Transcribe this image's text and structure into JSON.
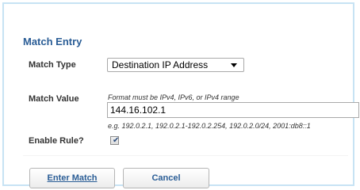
{
  "form": {
    "title": "Match Entry",
    "match_type_label": "Match Type",
    "match_type_value": "Destination IP Address",
    "match_value_label": "Match Value",
    "format_hint": "Format must be IPv4, IPv6, or IPv4 range",
    "match_value": "144.16.102.1",
    "example_text": "e.g. 192.0.2.1, 192.0.2.1-192.0.2.254, 192.0.2.0/24, 2001:db8::1",
    "enable_rule_label": "Enable Rule?",
    "enable_rule_checked": true
  },
  "buttons": {
    "enter_match": "Enter Match",
    "cancel": "Cancel"
  },
  "colors": {
    "accent": "#2a5d96",
    "panel_border": "#c7e3f4"
  },
  "icons": {
    "dropdown": "chevron-down-icon",
    "check": "checkmark-icon"
  }
}
